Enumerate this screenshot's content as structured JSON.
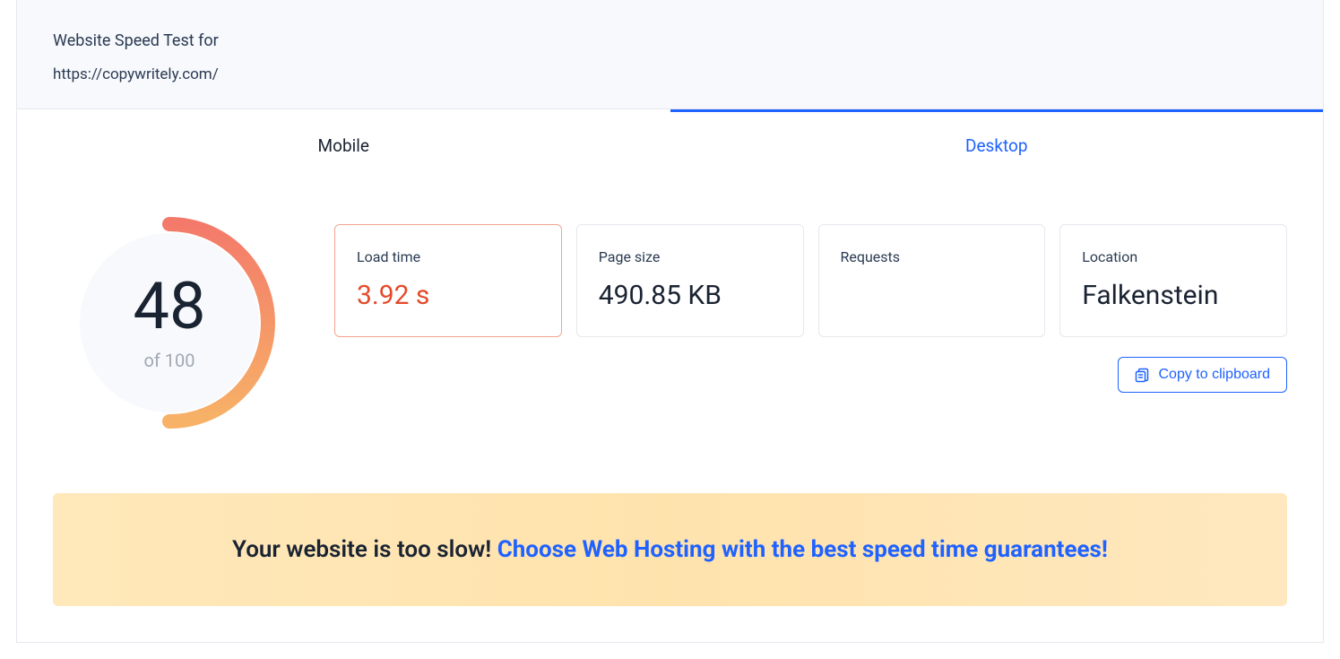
{
  "header": {
    "title": "Website Speed Test for",
    "url": "https://copywritely.com/"
  },
  "tabs": {
    "mobile": "Mobile",
    "desktop": "Desktop",
    "active": "desktop"
  },
  "score": {
    "value": "48",
    "of": "of 100",
    "percent": 48
  },
  "cards": [
    {
      "label": "Load time",
      "value": "3.92 s",
      "warn": true
    },
    {
      "label": "Page size",
      "value": "490.85 KB",
      "warn": false
    },
    {
      "label": "Requests",
      "value": "",
      "warn": false
    },
    {
      "label": "Location",
      "value": "Falkenstein",
      "warn": false
    }
  ],
  "copy_button": "Copy to clipboard",
  "banner": {
    "plain": "Your website is too slow! ",
    "highlight": "Choose Web Hosting with the best speed time guarantees!"
  }
}
